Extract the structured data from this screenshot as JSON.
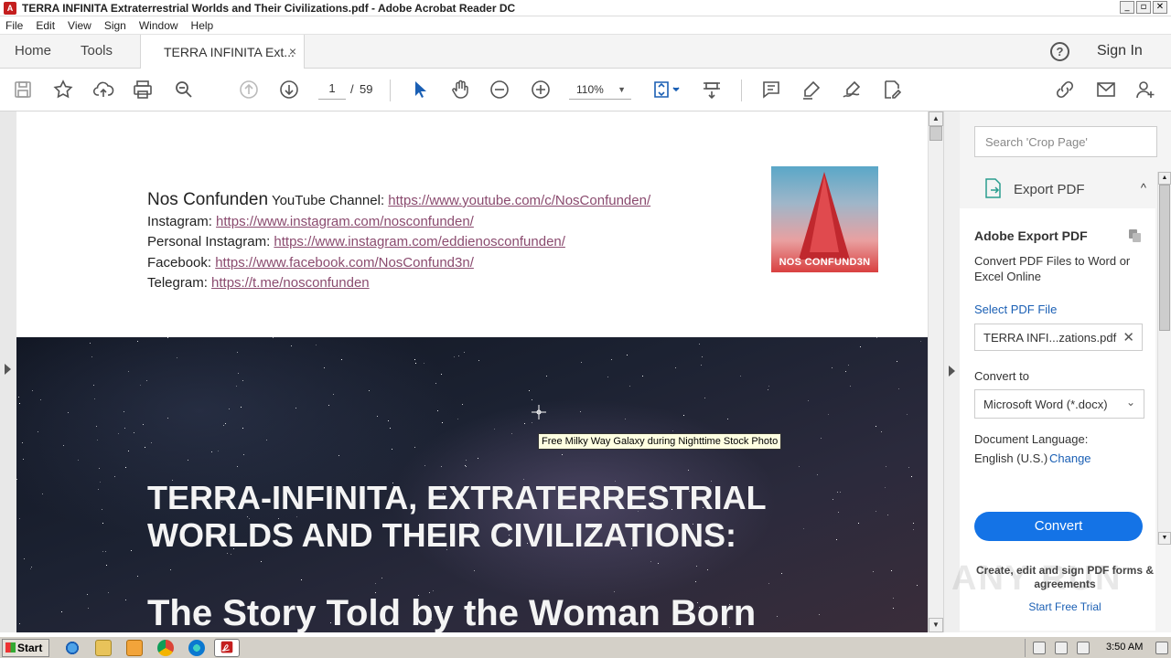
{
  "window": {
    "title": "TERRA INFINITA Extraterrestrial Worlds and Their Civilizations.pdf - Adobe Acrobat Reader DC",
    "app_icon": "A",
    "controls": {
      "minimize": "_",
      "restore": "▫",
      "close": "✕"
    }
  },
  "menu": [
    "File",
    "Edit",
    "View",
    "Sign",
    "Window",
    "Help"
  ],
  "tabs": {
    "home": "Home",
    "tools": "Tools",
    "document": "TERRA INFINITA Ext...",
    "close": "×"
  },
  "header_right": {
    "help": "?",
    "sign_in": "Sign In"
  },
  "toolbar": {
    "page_current": "1",
    "page_separator": "/",
    "page_total": "59",
    "zoom": "110%",
    "zoom_caret": "▼",
    "icons": [
      "save-icon",
      "bookmark-star-icon",
      "upload-cloud-icon",
      "print-icon",
      "zoom-search-icon",
      "page-up-icon",
      "page-down-icon",
      "select-arrow-icon",
      "hand-icon",
      "zoom-out-icon",
      "zoom-in-icon",
      "fit-page-icon",
      "scroll-mode-icon",
      "comment-icon",
      "highlight-icon",
      "sign-icon",
      "edit-pdf-icon",
      "share-link-icon",
      "email-icon",
      "add-user-icon"
    ]
  },
  "document": {
    "brand": "Nos Confunden",
    "links": [
      {
        "label": "YouTube Channel:",
        "url": "https://www.youtube.com/c/NosConfunden/"
      },
      {
        "label": "Instagram:",
        "url": "https://www.instagram.com/nosconfunden/"
      },
      {
        "label": "Personal Instagram:",
        "url": "https://www.instagram.com/eddienosconfunden/"
      },
      {
        "label": "Facebook:",
        "url": "https://www.facebook.com/NosConfund3n/"
      },
      {
        "label": "Telegram:",
        "url": "https://t.me/nosconfunden"
      }
    ],
    "logo_text": "NOS CONFUND3N",
    "heading_line1": "TERRA-INFINITA, EXTRATERRESTRIAL",
    "heading_line2": "WORLDS AND THEIR CIVILIZATIONS:",
    "heading_story": "The Story Told by the Woman Born",
    "tooltip": "Free Milky Way Galaxy during Nighttime Stock Photo"
  },
  "scroll": {
    "up": "▲",
    "down": "▼"
  },
  "right_pane": {
    "search_placeholder": "Search 'Crop Page'",
    "export_title": "Export PDF",
    "export_caret": "^",
    "card_title": "Adobe Export PDF",
    "card_desc": "Convert PDF Files to Word or Excel Online",
    "select_label": "Select PDF File",
    "file_name": "TERRA INFI...zations.pdf",
    "file_clear": "✕",
    "convert_to_label": "Convert to",
    "convert_to_value": "Microsoft Word (*.docx)",
    "convert_chevron": "⌄",
    "language_label": "Document Language:",
    "language_value": "English (U.S.)",
    "language_change": "Change",
    "convert_button": "Convert",
    "promo_text": "Create, edit and sign PDF forms & agreements",
    "promo_link": "Start Free Trial",
    "watermark": "ANY RUN"
  },
  "taskbar": {
    "start": "Start",
    "apps": [
      "ie-icon",
      "explorer-icon",
      "media-player-icon",
      "chrome-icon",
      "edge-icon",
      "acrobat-icon"
    ],
    "clock": "3:50 AM"
  },
  "colors": {
    "link": "#8a4a6e",
    "accent": "#1473e6",
    "title_text": "#f4f4f4"
  }
}
